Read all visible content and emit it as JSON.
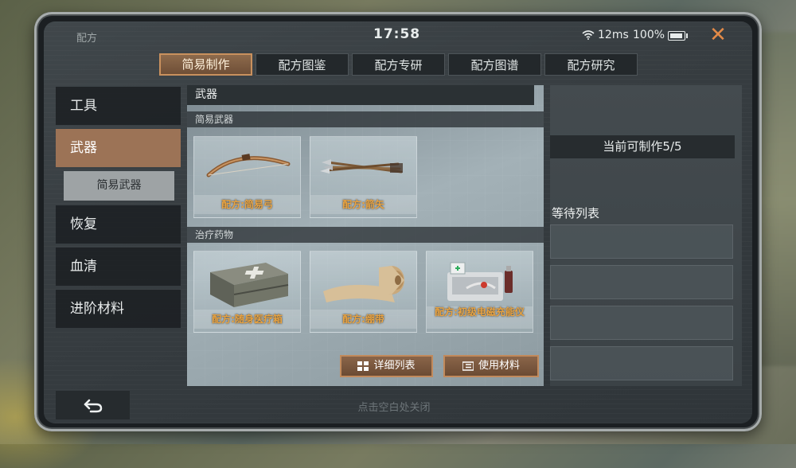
{
  "status_bar": {
    "app_title": "配方",
    "clock": "17:58",
    "ping": "12ms",
    "battery": "100%",
    "close_icon": "close-x-icon"
  },
  "tabs": [
    {
      "label": "简易制作",
      "active": true
    },
    {
      "label": "配方图鉴",
      "active": false
    },
    {
      "label": "配方专研",
      "active": false
    },
    {
      "label": "配方图谱",
      "active": false
    },
    {
      "label": "配方研究",
      "active": false
    }
  ],
  "sidebar": {
    "items": [
      {
        "label": "工具"
      },
      {
        "label": "武器",
        "active": true
      },
      {
        "label": "简易武器",
        "sub": true
      },
      {
        "label": "恢复"
      },
      {
        "label": "血清"
      },
      {
        "label": "进阶材料"
      }
    ]
  },
  "main": {
    "header": "武器",
    "sections": [
      {
        "title": "简易武器",
        "items": [
          {
            "label": "配方:简易弓",
            "icon": "bow-icon"
          },
          {
            "label": "配方:箭矢",
            "icon": "arrows-icon"
          }
        ]
      },
      {
        "title": "治疗药物",
        "items": [
          {
            "label": "配方:随身医疗箱",
            "icon": "medkit-icon"
          },
          {
            "label": "配方:绷带",
            "icon": "bandage-icon"
          },
          {
            "label": "配方:初级电磁充能仪",
            "icon": "emp-charger-icon"
          }
        ]
      }
    ],
    "buttons": {
      "detail_list": "详细列表",
      "use_materials": "使用材料"
    }
  },
  "right_panel": {
    "quota": "当前可制作5/5",
    "queue_title": "等待列表"
  },
  "footer": {
    "back_icon": "back-arrow-icon",
    "hint": "点击空白处关闭"
  },
  "colors": {
    "accent": "#9c7356",
    "accent_border": "#c9915e",
    "label_orange": "#e9a341",
    "close": "#e38a48"
  }
}
